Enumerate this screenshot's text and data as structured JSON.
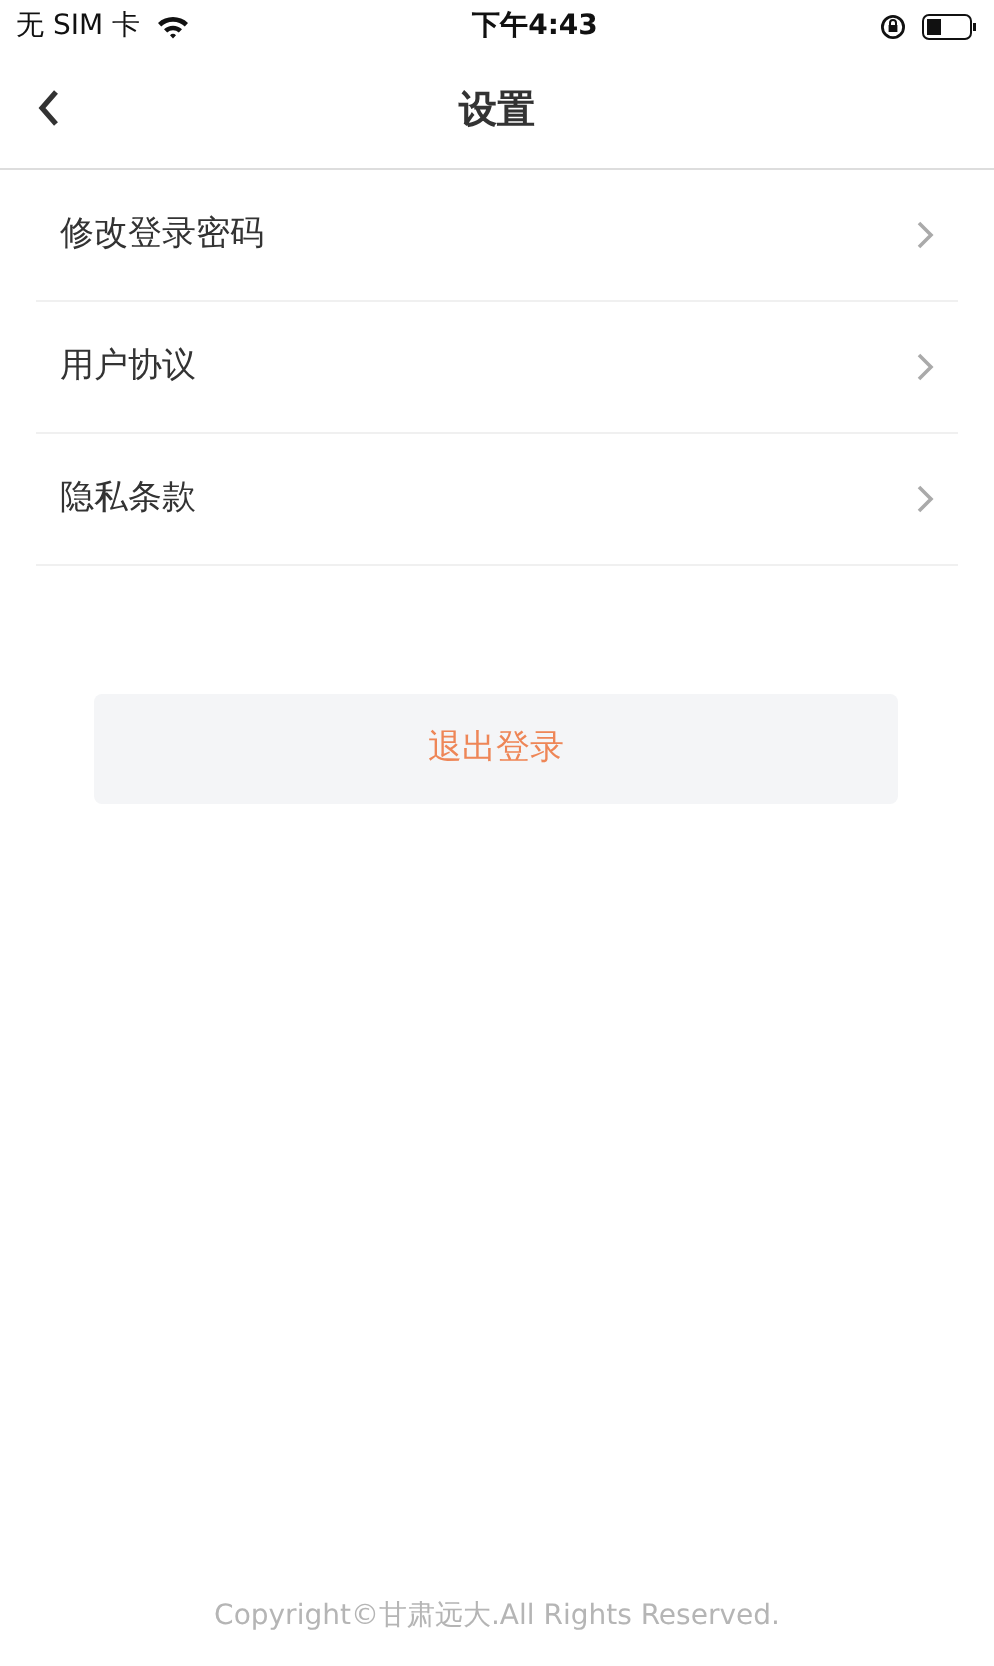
{
  "status_bar": {
    "carrier": "无 SIM 卡",
    "time": "下午4:43"
  },
  "nav": {
    "title": "设置"
  },
  "menu_items": [
    {
      "label": "修改登录密码"
    },
    {
      "label": "用户协议"
    },
    {
      "label": "隐私条款"
    }
  ],
  "logout_button": {
    "label": "退出登录"
  },
  "footer": {
    "text": "Copyright©甘肃远大.All Rights Reserved."
  }
}
